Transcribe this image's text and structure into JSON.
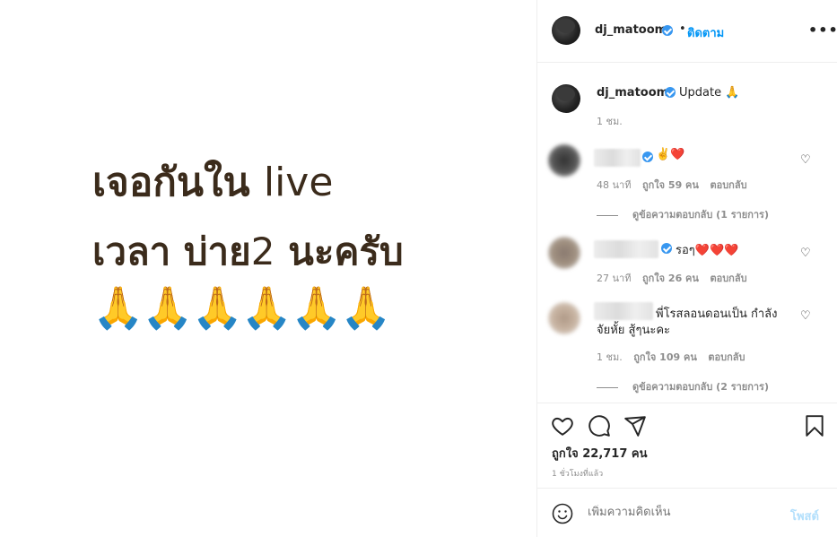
{
  "post_image": {
    "line1_thai": "เจอกันใน",
    "line1_latin": "live",
    "line2_thai": "เวลา บ่าย",
    "line2_latin": "2",
    "line2_end": "นะครับ",
    "hands": "🙏🙏🙏🙏🙏🙏"
  },
  "header": {
    "username": "dj_matoom",
    "dot": "•",
    "follow_label": "ติดตาม",
    "more": "•••"
  },
  "caption": {
    "username": "dj_matoom",
    "text": "Update 🙏",
    "time": "1 ชม."
  },
  "comments": [
    {
      "text": "✌️❤️",
      "time": "48 นาที",
      "likes": "ถูกใจ 59 คน",
      "reply": "ตอบกลับ",
      "view_replies": "ดูข้อความตอบกลับ (1 รายการ)"
    },
    {
      "text": "รอๆ❤️❤️❤️",
      "time": "27 นาที",
      "likes": "ถูกใจ 26 คน",
      "reply": "ตอบกลับ"
    },
    {
      "text_line1": "พี่โรสลอนดอนเป็น กำลัง",
      "text_line2": "จัยหั้ย สู้ๆนะคะ",
      "time": "1 ชม.",
      "likes": "ถูกใจ 109 คน",
      "reply": "ตอบกลับ",
      "view_replies": "ดูข้อความตอบกลับ (2 รายการ)"
    }
  ],
  "actions": {
    "likes": "ถูกใจ 22,717 คน",
    "ago": "1 ชั่วโมงที่แล้ว"
  },
  "add_comment": {
    "placeholder": "เพิ่มความคิดเห็น",
    "post_label": "โพสต์"
  },
  "colors": {
    "accent": "#0095f6",
    "verified": "#3897f0",
    "muted": "#8e8e8e",
    "post_disabled": "#b2dffc"
  },
  "icons": [
    "heart-icon",
    "comment-icon",
    "share-icon",
    "bookmark-icon",
    "emoji-icon",
    "small-heart-icon",
    "verified-icon",
    "more-icon"
  ]
}
